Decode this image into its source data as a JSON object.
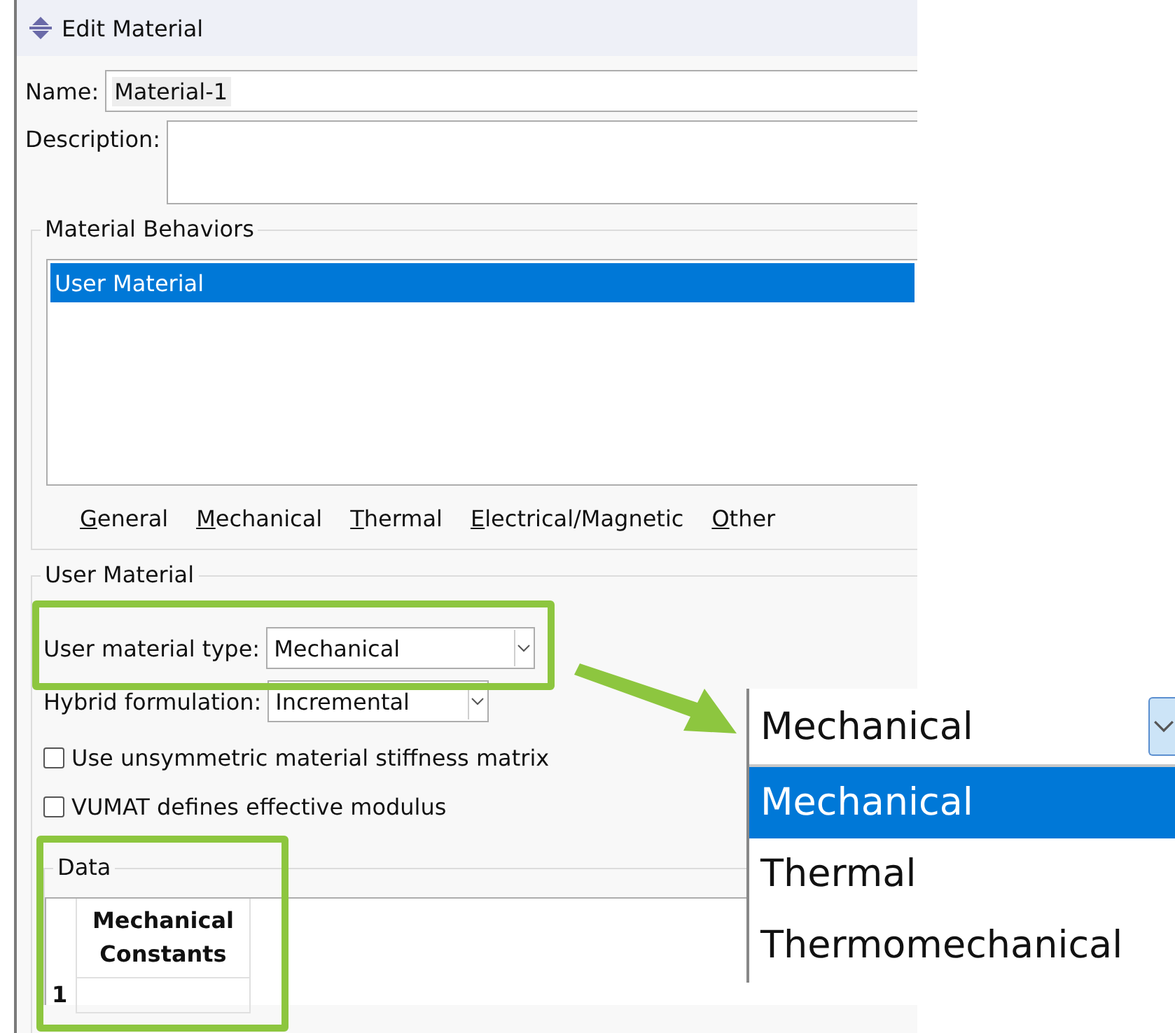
{
  "window": {
    "title": "Edit Material"
  },
  "name_field": {
    "label": "Name:",
    "value": "Material-1"
  },
  "description_field": {
    "label": "Description:"
  },
  "behaviors": {
    "title": "Material Behaviors",
    "items": [
      {
        "label": "User Material",
        "selected": true
      }
    ]
  },
  "menu": [
    {
      "label": "General"
    },
    {
      "label": "Mechanical"
    },
    {
      "label": "Thermal"
    },
    {
      "label": "Electrical/Magnetic"
    },
    {
      "label": "Other"
    }
  ],
  "user_material": {
    "title": "User Material",
    "type_select": {
      "label": "User material type:",
      "value": "Mechanical"
    },
    "hybrid_select": {
      "label": "Hybrid formulation:",
      "value": "Incremental"
    },
    "options": [
      {
        "label": "Use unsymmetric material stiffness matrix",
        "checked": false
      },
      {
        "label": "VUMAT defines effective modulus",
        "checked": false
      }
    ]
  },
  "data": {
    "title": "Data",
    "columns": [
      "Mechanical Constants"
    ],
    "rows": [
      {
        "index": "1"
      }
    ]
  },
  "zoomed_dropdown": {
    "value": "Mechanical",
    "options": [
      {
        "label": "Mechanical",
        "selected": true
      },
      {
        "label": "Thermal",
        "selected": false
      },
      {
        "label": "Thermomechanical",
        "selected": false
      }
    ]
  }
}
